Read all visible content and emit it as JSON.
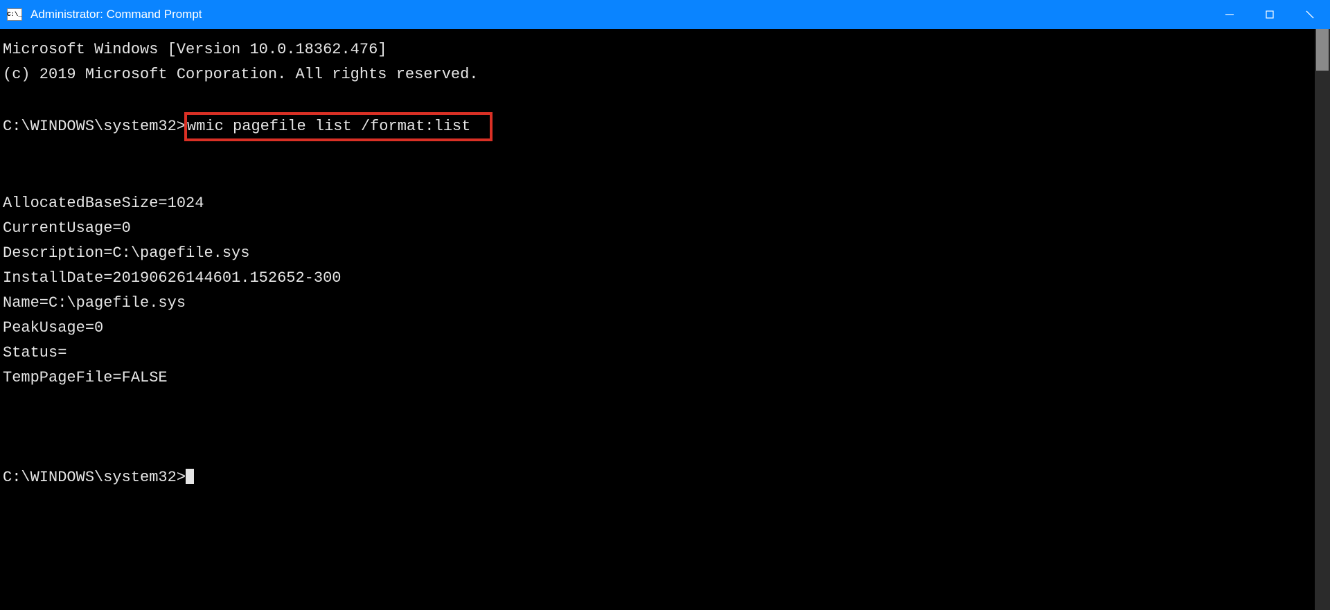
{
  "window": {
    "title": "Administrator: Command Prompt",
    "icon_label": "C:\\_"
  },
  "terminal": {
    "header_line1": "Microsoft Windows [Version 10.0.18362.476]",
    "header_line2": "(c) 2019 Microsoft Corporation. All rights reserved.",
    "prompt1_path": "C:\\WINDOWS\\system32>",
    "command": "wmic pagefile list /format:list",
    "output": {
      "AllocatedBaseSize": "AllocatedBaseSize=1024",
      "CurrentUsage": "CurrentUsage=0",
      "Description": "Description=C:\\pagefile.sys",
      "InstallDate": "InstallDate=20190626144601.152652-300",
      "Name": "Name=C:\\pagefile.sys",
      "PeakUsage": "PeakUsage=0",
      "Status": "Status=",
      "TempPageFile": "TempPageFile=FALSE"
    },
    "prompt2_path": "C:\\WINDOWS\\system32>"
  }
}
